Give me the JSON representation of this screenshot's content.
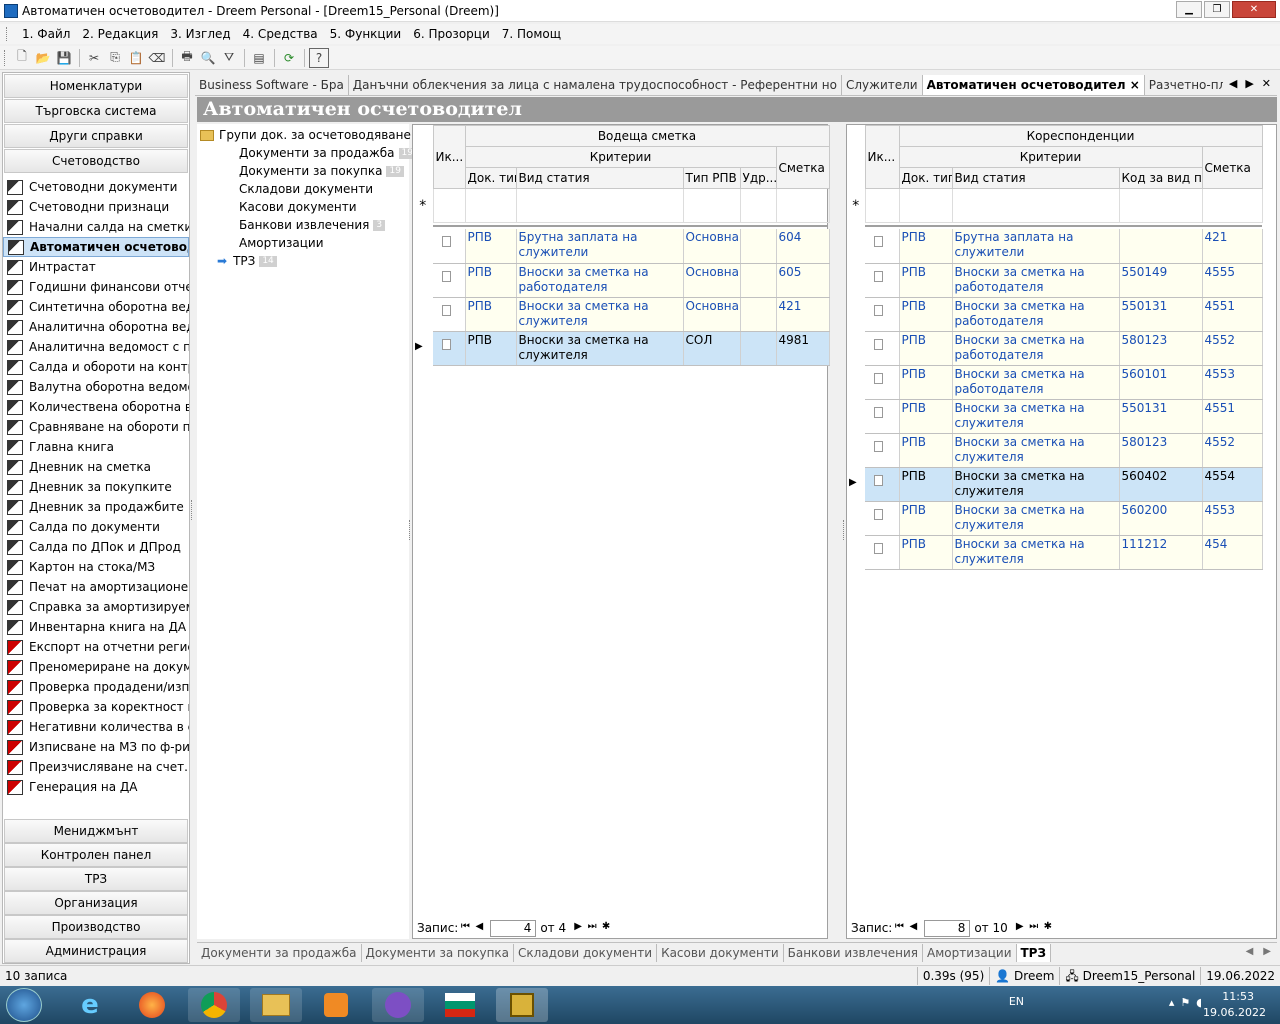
{
  "window": {
    "title": "Автоматичен осчетоводител - Dreem Personal - [Dreem15_Personal (Dreem)]"
  },
  "menu": [
    "1. Файл",
    "2. Редакция",
    "3. Изглед",
    "4. Средства",
    "5. Функции",
    "6. Прозорци",
    "7. Помощ"
  ],
  "leftnav": {
    "headers_top": [
      "Номенклатури",
      "Търговска система",
      "Други справки",
      "Счетоводство"
    ],
    "items": [
      {
        "label": "Счетоводни документи",
        "icon": "gray"
      },
      {
        "label": "Счетоводни признаци",
        "icon": "gray"
      },
      {
        "label": "Начални салда на сметки",
        "icon": "gray"
      },
      {
        "label": "Автоматичен осчетовод...",
        "icon": "gray",
        "selected": true
      },
      {
        "label": "Интрастат",
        "icon": "gray"
      },
      {
        "label": "Годишни финансови отче...",
        "icon": "gray"
      },
      {
        "label": "Синтетична оборотна вед...",
        "icon": "gray"
      },
      {
        "label": "Аналитична оборотна вед...",
        "icon": "gray"
      },
      {
        "label": "Аналитична ведомост с п...",
        "icon": "gray"
      },
      {
        "label": "Салда и обороти на контр...",
        "icon": "gray"
      },
      {
        "label": "Валутна оборотна ведомост",
        "icon": "gray"
      },
      {
        "label": "Количествена оборотна в...",
        "icon": "gray"
      },
      {
        "label": "Сравняване на обороти п...",
        "icon": "gray"
      },
      {
        "label": "Главна книга",
        "icon": "gray"
      },
      {
        "label": "Дневник на сметка",
        "icon": "gray"
      },
      {
        "label": "Дневник за покупките",
        "icon": "gray"
      },
      {
        "label": "Дневник за продажбите",
        "icon": "gray"
      },
      {
        "label": "Салда по документи",
        "icon": "gray"
      },
      {
        "label": "Салда по ДПок и ДПрод",
        "icon": "gray"
      },
      {
        "label": "Картон на стока/МЗ",
        "icon": "gray"
      },
      {
        "label": "Печат на амортизационен...",
        "icon": "gray"
      },
      {
        "label": "Справка за амортизируем...",
        "icon": "gray"
      },
      {
        "label": "Инвентарна книга на ДА",
        "icon": "gray"
      },
      {
        "label": "Експорт на отчетни регист...",
        "icon": "red"
      },
      {
        "label": "Преномериране на докум...",
        "icon": "red"
      },
      {
        "label": "Проверка продадени/изп...",
        "icon": "red"
      },
      {
        "label": "Проверка за коректност н...",
        "icon": "red"
      },
      {
        "label": "Негативни количества в с...",
        "icon": "red"
      },
      {
        "label": "Изписване на МЗ по ф-ри...",
        "icon": "red"
      },
      {
        "label": "Преизчисляване на счет. ...",
        "icon": "red"
      },
      {
        "label": "Генерация на ДА",
        "icon": "red"
      }
    ],
    "headers_bottom": [
      "Мениджмънт",
      "Контролен панел",
      "ТРЗ",
      "Организация",
      "Производство",
      "Администрация"
    ]
  },
  "tabs_top": [
    {
      "label": "Business Software - Бра"
    },
    {
      "label": "Данъчни облекчения за лица с намалена трудоспособност - Референтни но"
    },
    {
      "label": "Служители"
    },
    {
      "label": "Автоматичен осчетоводител ×",
      "active": true
    },
    {
      "label": "Разчетно-платежни ведомости"
    }
  ],
  "page_title": "Автоматичен осчетоводител",
  "tree": {
    "root": "Групи док. за осчетоводяване",
    "children": [
      {
        "label": "Документи за продажба",
        "count": "19"
      },
      {
        "label": "Документи за покупка",
        "count": "19"
      },
      {
        "label": "Складови документи",
        "count": ""
      },
      {
        "label": "Касови документи",
        "count": ""
      },
      {
        "label": "Банкови извлечения",
        "count": "3"
      },
      {
        "label": "Амортизации",
        "count": ""
      },
      {
        "label": "ТРЗ",
        "count": "14",
        "selected": true
      }
    ]
  },
  "lead": {
    "group": "Водеща сметка",
    "criteria": "Критерии",
    "cols": {
      "icon": "Ик...",
      "doc": "Док. тип",
      "kind": "Вид статия",
      "type": "Тип РПВ",
      "ded": "Удр...",
      "acc": "Сметка"
    },
    "rows": [
      {
        "doc": "РПВ",
        "kind": "Брутна заплата на служители",
        "type": "Основна",
        "ded": "",
        "acc": "604"
      },
      {
        "doc": "РПВ",
        "kind": "Вноски за сметка на работодателя",
        "type": "Основна",
        "ded": "",
        "acc": "605"
      },
      {
        "doc": "РПВ",
        "kind": "Вноски за сметка на служителя",
        "type": "Основна",
        "ded": "",
        "acc": "421"
      },
      {
        "doc": "РПВ",
        "kind": "Вноски за сметка на служителя",
        "type": "СОЛ",
        "ded": "",
        "acc": "4981",
        "selected": true
      }
    ],
    "nav": {
      "label": "Запис:",
      "current": "4",
      "of": "от 4"
    }
  },
  "corr": {
    "group": "Кореспонденции",
    "criteria": "Критерии",
    "cols": {
      "icon": "Ик...",
      "doc": "Док. тип",
      "kind": "Вид статия",
      "code": "Код за вид п...",
      "acc": "Сметка"
    },
    "rows": [
      {
        "doc": "РПВ",
        "kind": "Брутна заплата на служители",
        "code": "",
        "acc": "421"
      },
      {
        "doc": "РПВ",
        "kind": "Вноски за сметка на работодателя",
        "code": "550149",
        "acc": "4555"
      },
      {
        "doc": "РПВ",
        "kind": "Вноски за сметка на работодателя",
        "code": "550131",
        "acc": "4551"
      },
      {
        "doc": "РПВ",
        "kind": "Вноски за сметка на работодателя",
        "code": "580123",
        "acc": "4552"
      },
      {
        "doc": "РПВ",
        "kind": "Вноски за сметка на работодателя",
        "code": "560101",
        "acc": "4553"
      },
      {
        "doc": "РПВ",
        "kind": "Вноски за сметка на служителя",
        "code": "550131",
        "acc": "4551"
      },
      {
        "doc": "РПВ",
        "kind": "Вноски за сметка на служителя",
        "code": "580123",
        "acc": "4552"
      },
      {
        "doc": "РПВ",
        "kind": "Вноски за сметка на служителя",
        "code": "560402",
        "acc": "4554",
        "selected": true
      },
      {
        "doc": "РПВ",
        "kind": "Вноски за сметка на служителя",
        "code": "560200",
        "acc": "4553"
      },
      {
        "doc": "РПВ",
        "kind": "Вноски за сметка на служителя",
        "code": "111212",
        "acc": "454"
      }
    ],
    "nav": {
      "label": "Запис:",
      "current": "8",
      "of": "от 10"
    }
  },
  "tabs_bottom": [
    {
      "label": "Документи за продажба"
    },
    {
      "label": "Документи за покупка"
    },
    {
      "label": "Складови документи"
    },
    {
      "label": "Касови документи"
    },
    {
      "label": "Банкови извлечения"
    },
    {
      "label": "Амортизации"
    },
    {
      "label": "ТРЗ",
      "active": true
    }
  ],
  "status": {
    "left": "10 записа",
    "time": "0.39s (95)",
    "user": "Dreem",
    "db": "Dreem15_Personal",
    "date": "19.06.2022"
  },
  "tray": {
    "lang": "EN",
    "time": "11:53",
    "date": "19.06.2022"
  }
}
